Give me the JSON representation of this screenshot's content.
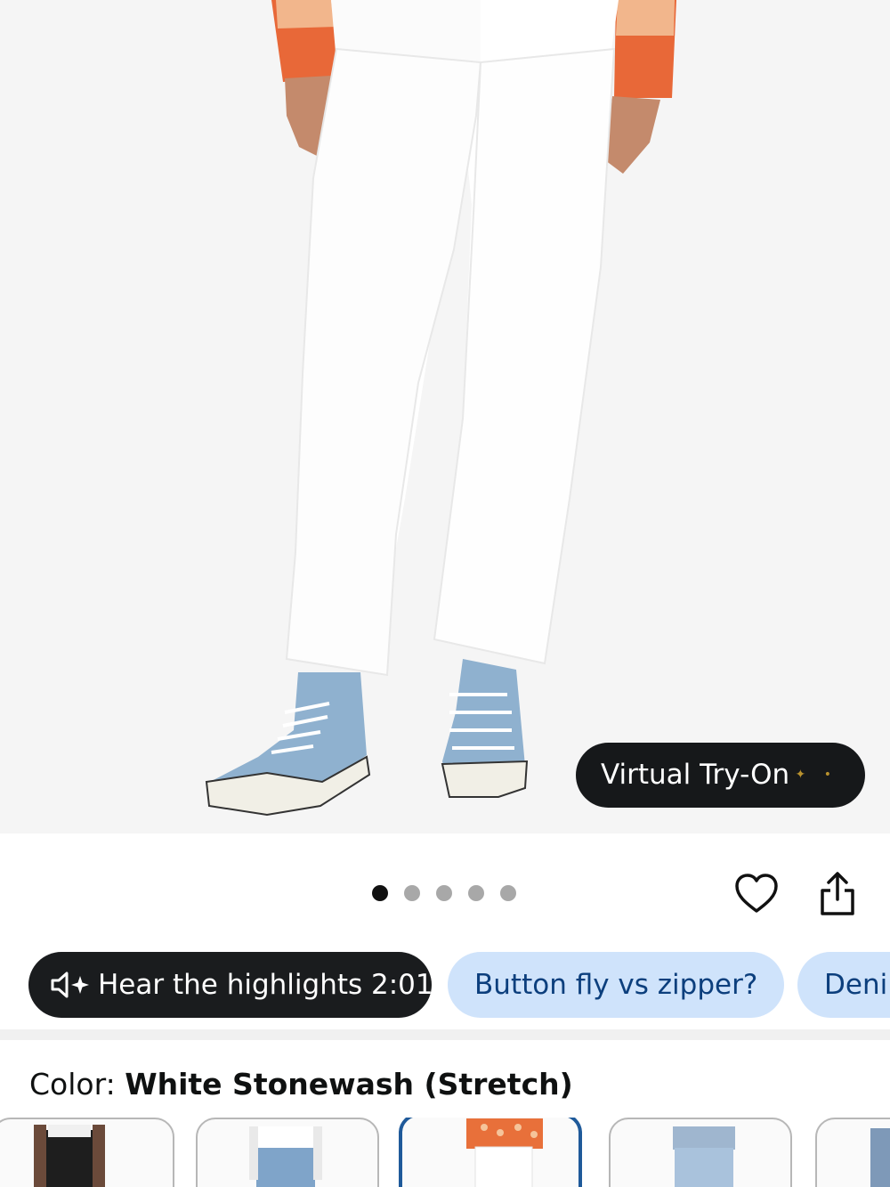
{
  "product_image": {
    "alt": "White straight-leg jeans with blue high-top sneakers"
  },
  "virtual_tryon": {
    "label": "Virtual Try-On"
  },
  "carousel": {
    "total": 5,
    "active_index": 0
  },
  "actions": {
    "wishlist_icon": "heart-icon",
    "share_icon": "share-icon"
  },
  "chips": [
    {
      "label": "Hear the highlights 2:01",
      "icon": "speaker-sparkle-icon"
    },
    {
      "label": "Button fly vs zipper?"
    },
    {
      "label": "Denim"
    }
  ],
  "color": {
    "label": "Color:",
    "value": "White Stonewash (Stretch)"
  },
  "swatches": [
    {
      "name": "black"
    },
    {
      "name": "light-blue"
    },
    {
      "name": "white-stonewash",
      "selected": true
    },
    {
      "name": "light-wash"
    },
    {
      "name": "medium-wash"
    }
  ],
  "colors": {
    "accent_blue": "#1f5a9a",
    "chip_blue_bg": "#cfe3fb",
    "chip_blue_text": "#0c3f7d",
    "dark_chip": "#1a1c1e"
  }
}
